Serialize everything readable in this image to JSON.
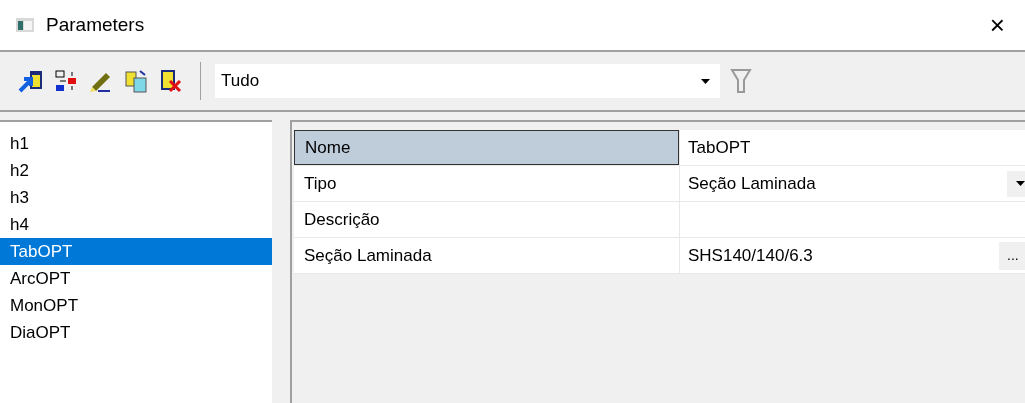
{
  "window": {
    "title": "Parameters",
    "close": "×"
  },
  "toolbar": {
    "filter": {
      "value": "Tudo"
    }
  },
  "list": {
    "items": [
      {
        "label": "h1",
        "selected": false
      },
      {
        "label": "h2",
        "selected": false
      },
      {
        "label": "h3",
        "selected": false
      },
      {
        "label": "h4",
        "selected": false
      },
      {
        "label": "TabOPT",
        "selected": true
      },
      {
        "label": "ArcOPT",
        "selected": false
      },
      {
        "label": "MonOPT",
        "selected": false
      },
      {
        "label": "DiaOPT",
        "selected": false
      }
    ]
  },
  "properties": [
    {
      "name": "Nome",
      "value": "TabOPT",
      "kind": "text",
      "selected": true
    },
    {
      "name": "Tipo",
      "value": "Seção Laminada",
      "kind": "dropdown",
      "selected": false
    },
    {
      "name": "Descrição",
      "kind": "text",
      "selected": false
    },
    {
      "name": "Seção Laminada",
      "value": "SHS140/140/6.3",
      "kind": "ellipsis",
      "button": "...",
      "selected": false
    }
  ]
}
